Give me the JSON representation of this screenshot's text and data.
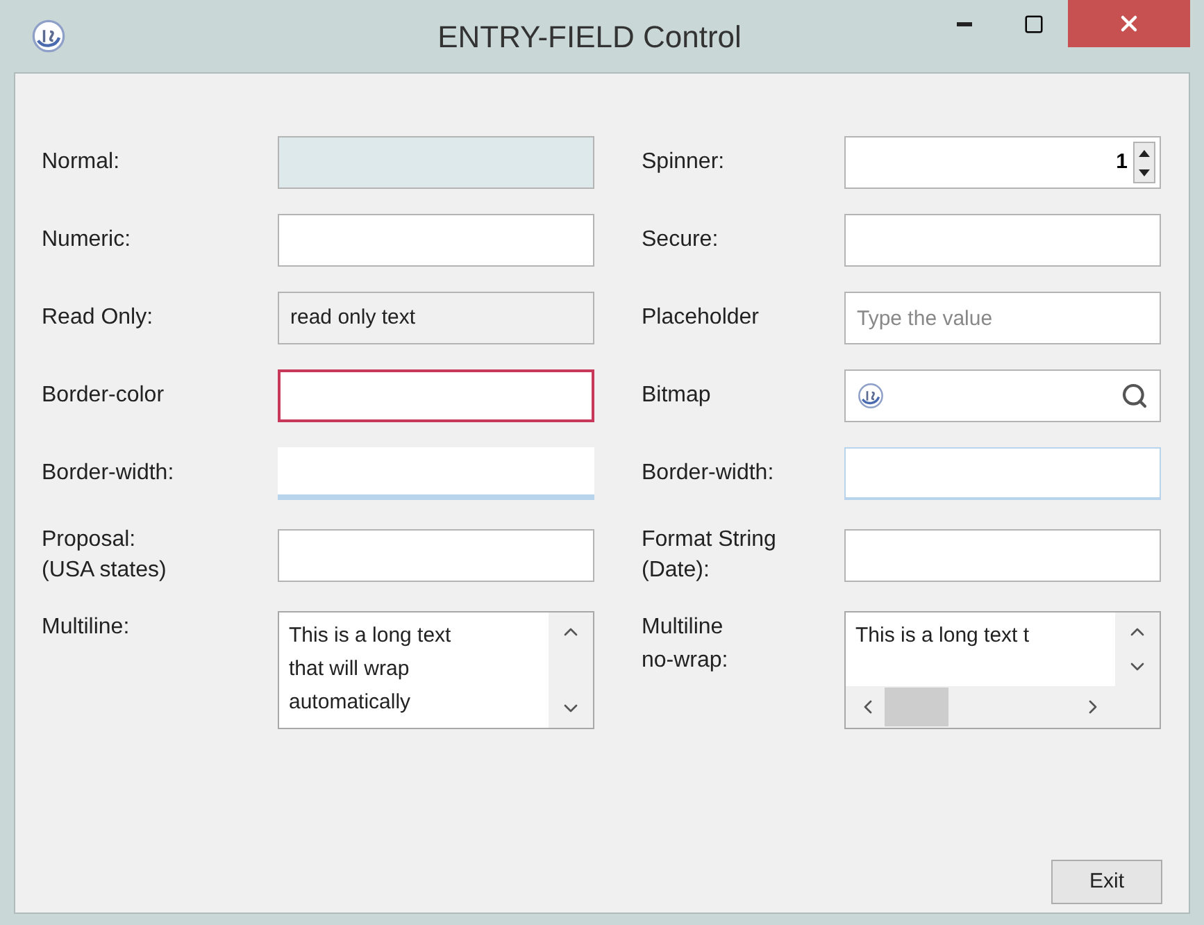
{
  "window": {
    "title": "ENTRY-FIELD Control"
  },
  "rows": [
    {
      "left": {
        "label": "Normal:",
        "kind": "normal"
      },
      "right": {
        "label": "Spinner:",
        "kind": "spinner",
        "value": "1"
      }
    },
    {
      "left": {
        "label": "Numeric:",
        "kind": "plain"
      },
      "right": {
        "label": "Secure:",
        "kind": "plain"
      }
    },
    {
      "left": {
        "label": "Read Only:",
        "kind": "readonly",
        "value": "read only text"
      },
      "right": {
        "label": "Placeholder",
        "kind": "plain",
        "placeholder": "Type the value"
      }
    },
    {
      "left": {
        "label": "Border-color",
        "kind": "colored",
        "color": "#c8385a"
      },
      "right": {
        "label": "Bitmap",
        "kind": "bitmap"
      }
    },
    {
      "left": {
        "label": "Border-width:",
        "kind": "underline"
      },
      "right": {
        "label": "Border-width:",
        "kind": "thin_blue"
      }
    },
    {
      "left": {
        "label": "Proposal:\n(USA states)",
        "kind": "plain"
      },
      "right": {
        "label": "Format String\n(Date):",
        "kind": "plain"
      }
    }
  ],
  "multiline": {
    "label": "Multiline:",
    "lines": [
      "This is a long text",
      "that will wrap",
      "automatically"
    ]
  },
  "multiline_nowrap": {
    "label": "Multiline\nno-wrap:",
    "lines": [
      "This is a long text t"
    ]
  },
  "buttons": [
    {
      "label": "Exit"
    }
  ]
}
